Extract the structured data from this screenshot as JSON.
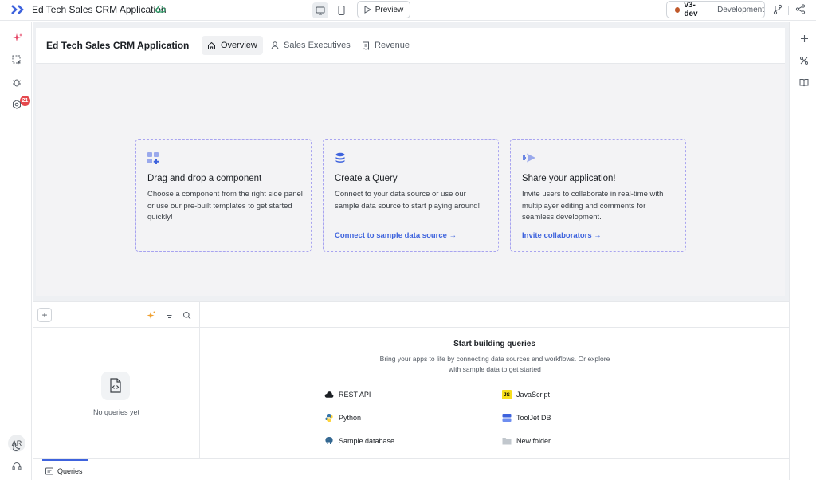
{
  "topbar": {
    "app_title": "Ed Tech Sales CRM Application",
    "preview_label": "Preview",
    "branch": "v3-dev",
    "environment": "Development"
  },
  "sidebar": {
    "notification_count": "21",
    "avatar_initials": "AR"
  },
  "page": {
    "title": "Ed Tech Sales CRM Application",
    "tabs": [
      {
        "label": "Overview",
        "icon": "home-icon",
        "active": true
      },
      {
        "label": "Sales Executives",
        "icon": "user-icon",
        "active": false
      },
      {
        "label": "Revenue",
        "icon": "receipt-icon",
        "active": false
      }
    ]
  },
  "cards": [
    {
      "title": "Drag and drop a component",
      "description": "Choose a component from the right side panel or use our pre-built templates to get started quickly!",
      "link": ""
    },
    {
      "title": "Create a Query",
      "description": "Connect to your data source or use our sample data source to start playing around!",
      "link": "Connect to sample data source →"
    },
    {
      "title": "Share your application!",
      "description": "Invite users to collaborate in real-time with multiplayer editing and comments for seamless development.",
      "link": "Invite collaborators →"
    }
  ],
  "query_panel": {
    "empty_text": "No queries yet",
    "main_title": "Start building queries",
    "main_desc": "Bring your apps to life by connecting data sources and workflows. Or explore with sample data to get started",
    "datasources": [
      {
        "label": "REST API",
        "icon": "rest-api-icon"
      },
      {
        "label": "JavaScript",
        "icon": "javascript-icon"
      },
      {
        "label": "Python",
        "icon": "python-icon"
      },
      {
        "label": "ToolJet DB",
        "icon": "tooljet-db-icon"
      },
      {
        "label": "Sample database",
        "icon": "postgres-icon"
      },
      {
        "label": "New folder",
        "icon": "folder-icon"
      }
    ],
    "bottom_tab": "Queries"
  },
  "colors": {
    "accent": "#3e63dd",
    "card_border": "#a8a4f0",
    "badge": "#e5484d",
    "env_dot": "#c0582a"
  }
}
